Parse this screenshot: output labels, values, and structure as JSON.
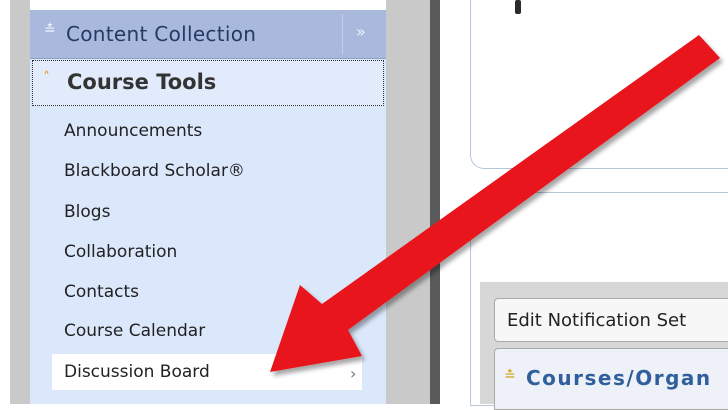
{
  "sidebar": {
    "content_collection_label": "Content Collection",
    "course_tools_label": "Course Tools",
    "items": [
      {
        "label": "Announcements"
      },
      {
        "label": "Blackboard Scholar®"
      },
      {
        "label": "Blogs"
      },
      {
        "label": "Collaboration"
      },
      {
        "label": "Contacts"
      },
      {
        "label": "Course Calendar"
      },
      {
        "label": "Discussion Board"
      }
    ],
    "hovered_item": "Discussion Board"
  },
  "main": {
    "edit_notification_button": "Edit Notification Set",
    "courses_section_label": "Courses/Organ"
  },
  "annotation": {
    "arrow_color": "#e8151b"
  },
  "colors": {
    "sidebar_bg": "#dbe7fb",
    "header_bg": "#a8b9dd",
    "accent_chevron": "#d6a21e",
    "link_blue": "#2f5f9c"
  }
}
